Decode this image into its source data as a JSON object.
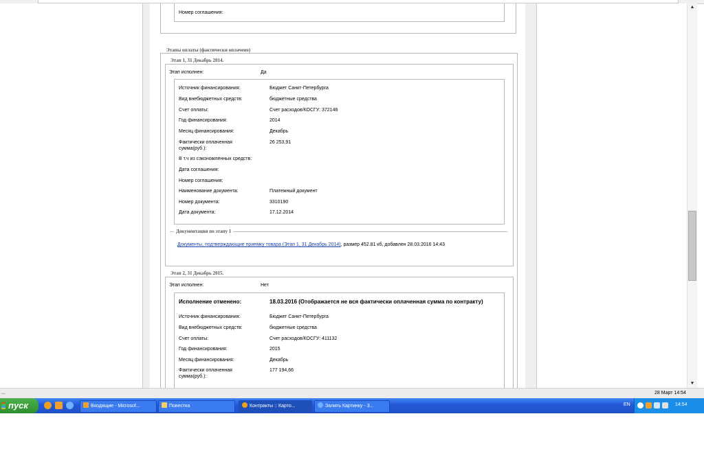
{
  "status_bar": {
    "left": "...",
    "datetime": "28 Март 14:54"
  },
  "top_block": {
    "label": "Номер соглашения:"
  },
  "payments": {
    "legend": "Этапы оплаты (фактически оплачено)",
    "stage1": {
      "legend": "Этап 1, 31 Декабрь 2014.",
      "done_label": "Этап исполнен:",
      "done_value": "Да",
      "rows": [
        {
          "label": "Источник финансирования:",
          "value": "Бюджет Санкт-Петербурга"
        },
        {
          "label": "Вид внебюджетных средств:",
          "value": "бюджетные средства"
        },
        {
          "label": "Счет оплаты:",
          "value": "Счет расходов/КОСГУ: 372146"
        },
        {
          "label": "Год финансирования:",
          "value": "2014"
        },
        {
          "label": "Месяц финансирования:",
          "value": "Декабрь"
        },
        {
          "label": "Фактически оплаченная сумма(руб.):",
          "value": "26 253,91"
        },
        {
          "label": "В т.ч из сэкономленных средств:",
          "value": ""
        },
        {
          "label": "Дата соглашения:",
          "value": ""
        },
        {
          "label": "Номер соглашения:",
          "value": ""
        },
        {
          "label": "Наименование документа:",
          "value": "Платежный документ"
        },
        {
          "label": "Номер документа:",
          "value": "3310190"
        },
        {
          "label": "Дата документа:",
          "value": "17.12.2014"
        }
      ],
      "docs_legend": "Документация по этапу 1",
      "doc_link": "Документы, подтверждающие приемку товара (Этап 1, 31 Декабрь 2014)",
      "doc_meta": ", размер 452.81 кб, добавлен 28.03.2016 14:43"
    },
    "stage2": {
      "legend": "Этап 2, 31 Декабрь 2015.",
      "done_label": "Этап исполнен:",
      "done_value": "Нет",
      "cancel_label": "Исполнение отменено:",
      "cancel_value": "18.03.2016 (Отображается не вся фактически оплаченная сумма по контракту)",
      "rows": [
        {
          "label": "Источник финансирования:",
          "value": "Бюджет Санкт-Петербурга"
        },
        {
          "label": "Вид внебюджетных средств:",
          "value": "бюджетные средства"
        },
        {
          "label": "Счет оплаты:",
          "value": "Счет расходов/КОСГУ: 411132"
        },
        {
          "label": "Год финансирования:",
          "value": "2015"
        },
        {
          "label": "Месяц финансирования:",
          "value": "Декабрь"
        },
        {
          "label": "Фактически оплаченная сумма(руб.):",
          "value": "177 194,66"
        }
      ]
    }
  },
  "taskbar": {
    "start": "пуск",
    "tasks": [
      "Входящие - Microsof...",
      "Повестка",
      "Контракты :: Карто...",
      "Залить Картинку - З..."
    ],
    "lang": "EN",
    "clock": "14:54"
  },
  "colors": {
    "taskbar": "#2458d8",
    "start": "#3a9e3a",
    "tray": "#1a8ee8",
    "link": "#1a3ea8"
  }
}
